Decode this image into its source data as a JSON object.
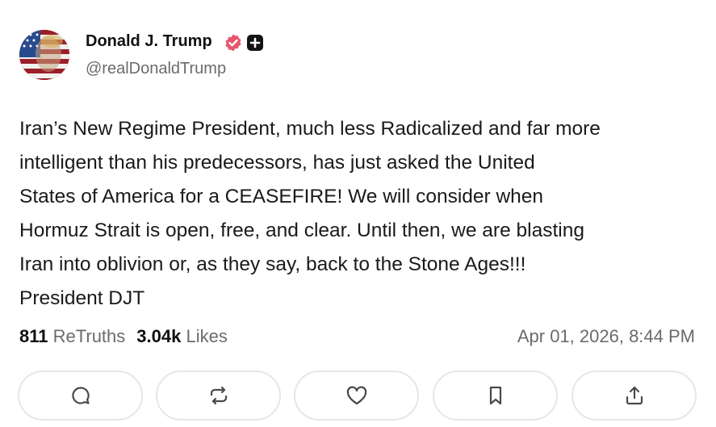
{
  "author": {
    "name": "Donald J. Trump",
    "handle": "@realDonaldTrump",
    "verified_icon": "verified-badge-icon",
    "plus_icon": "plus-badge-icon"
  },
  "post": {
    "lines": [
      "Iran’s New Regime President, much less Radicalized and far more",
      "intelligent than his predecessors, has just asked the United",
      "States of America for a CEASEFIRE! We will consider when",
      "Hormuz Strait is open, free, and clear. Until then, we are blasting",
      "Iran into oblivion or, as they say, back to the Stone Ages!!!",
      "President DJT"
    ]
  },
  "stats": {
    "retruths_count": "811",
    "retruths_label": "ReTruths",
    "likes_count": "3.04k",
    "likes_label": "Likes",
    "timestamp": "Apr 01, 2026, 8:44 PM"
  },
  "actions": [
    {
      "icon": "reply-icon"
    },
    {
      "icon": "retruth-icon"
    },
    {
      "icon": "like-heart-icon"
    },
    {
      "icon": "bookmark-icon"
    },
    {
      "icon": "share-icon"
    }
  ],
  "colors": {
    "verified_badge": "#e5566e",
    "text_primary": "#111111",
    "text_secondary": "#6b6b6b",
    "button_border": "#e6e6e6"
  }
}
